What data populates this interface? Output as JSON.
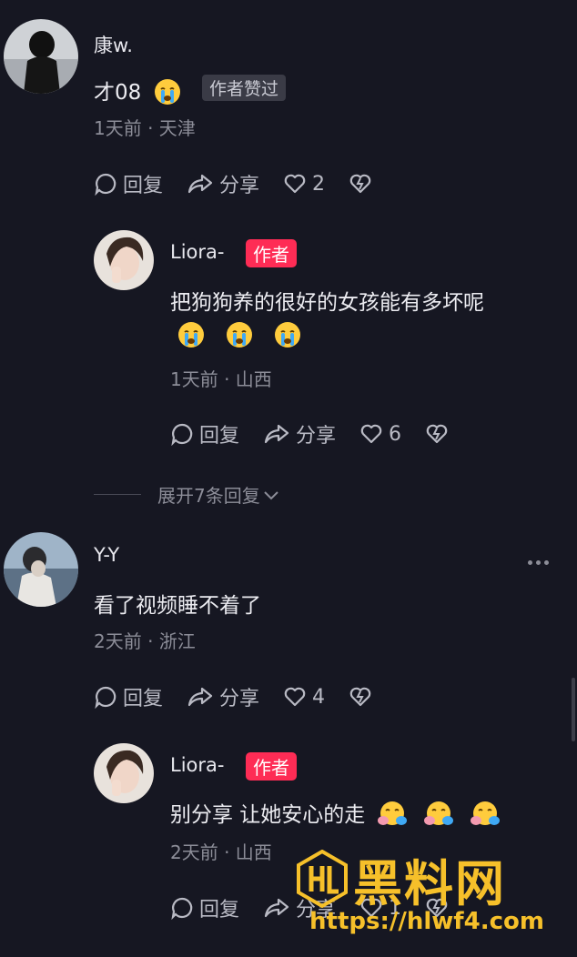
{
  "comments": [
    {
      "user": "康w.",
      "text": "才08",
      "emoji_count": 1,
      "liked_badge": "作者赞过",
      "meta": "1天前 · 天津",
      "reply_label": "回复",
      "share_label": "分享",
      "likes": "2"
    },
    {
      "user": "Liora-",
      "author_badge": "作者",
      "text": "把狗狗养的很好的女孩能有多坏呢",
      "emoji_count": 3,
      "meta": "1天前 · 山西",
      "reply_label": "回复",
      "share_label": "分享",
      "likes": "6"
    },
    {
      "user": "Y-Y",
      "text": "看了视频睡不着了",
      "meta": "2天前 · 浙江",
      "reply_label": "回复",
      "share_label": "分享",
      "likes": "4"
    },
    {
      "user": "Liora-",
      "author_badge": "作者",
      "text": "别分享 让她安心的走",
      "emoji_count": 3,
      "meta": "2天前 · 山西",
      "reply_label": "回复",
      "share_label": "分享",
      "likes": "1"
    }
  ],
  "expand_label": "展开7条回复",
  "watermark": {
    "brand": "黑料网",
    "url": "https://hlwf4.com"
  },
  "colors": {
    "background": "#161722",
    "author_badge": "#fe2c55",
    "watermark": "#f6c02a",
    "muted": "#8c8d98"
  },
  "icons": [
    "comment-icon",
    "share-icon",
    "heart-icon",
    "dislike-heart-icon",
    "chevron-down-icon",
    "more-icon",
    "crying-emoji",
    "hugging-emoji"
  ]
}
